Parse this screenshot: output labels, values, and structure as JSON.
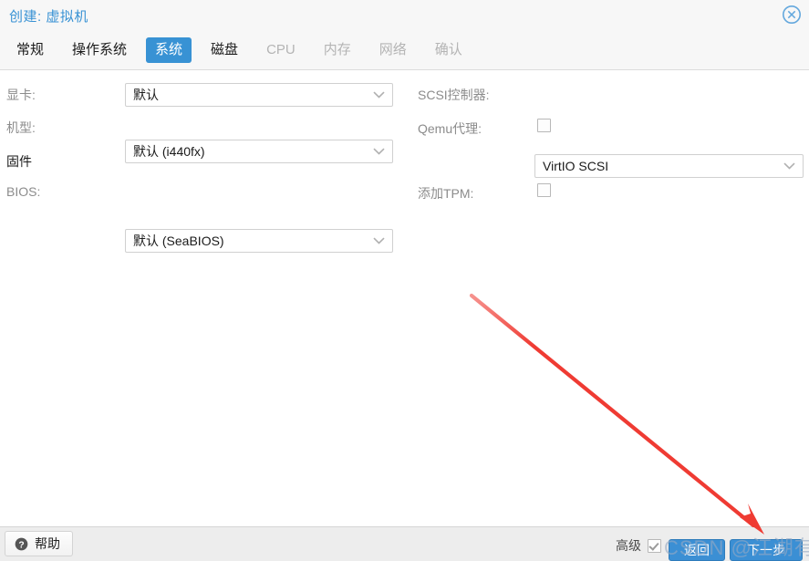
{
  "dialog": {
    "title": "创建: 虚拟机",
    "close_icon": "close-circle-icon"
  },
  "tabs": [
    {
      "label": "常规",
      "state": "enabled"
    },
    {
      "label": "操作系统",
      "state": "enabled"
    },
    {
      "label": "系统",
      "state": "active"
    },
    {
      "label": "磁盘",
      "state": "enabled"
    },
    {
      "label": "CPU",
      "state": "disabled"
    },
    {
      "label": "内存",
      "state": "disabled"
    },
    {
      "label": "网络",
      "state": "disabled"
    },
    {
      "label": "确认",
      "state": "disabled"
    }
  ],
  "form": {
    "graphics_card": {
      "label": "显卡:",
      "value": "默认"
    },
    "machine_type": {
      "label": "机型:",
      "value": "默认 (i440fx)"
    },
    "firmware_section": {
      "label": "固件"
    },
    "bios": {
      "label": "BIOS:",
      "value": "默认 (SeaBIOS)"
    },
    "scsi_controller": {
      "label": "SCSI控制器:",
      "value": "VirtIO SCSI"
    },
    "qemu_agent": {
      "label": "Qemu代理:",
      "checked": false
    },
    "add_tpm": {
      "label": "添加TPM:",
      "checked": false
    }
  },
  "footer": {
    "help_label": "帮助",
    "help_icon": "question-circle-icon",
    "advanced_label": "高级",
    "advanced_checked": true,
    "back_label": "返回",
    "next_label": "下一步"
  },
  "annotation": {
    "arrow_color": "#ef3b33",
    "arrow_from": "517,324",
    "arrow_to": "836,584"
  },
  "watermark": {
    "text": "CSDN @江湖有缘"
  },
  "colors": {
    "accent": "#3892D4",
    "title": "#3892D4",
    "header_bg": "#f7f7f7",
    "footer_bg": "#ededed",
    "label": "#8c8c8c",
    "disabled_tab": "#b4b4b4"
  }
}
